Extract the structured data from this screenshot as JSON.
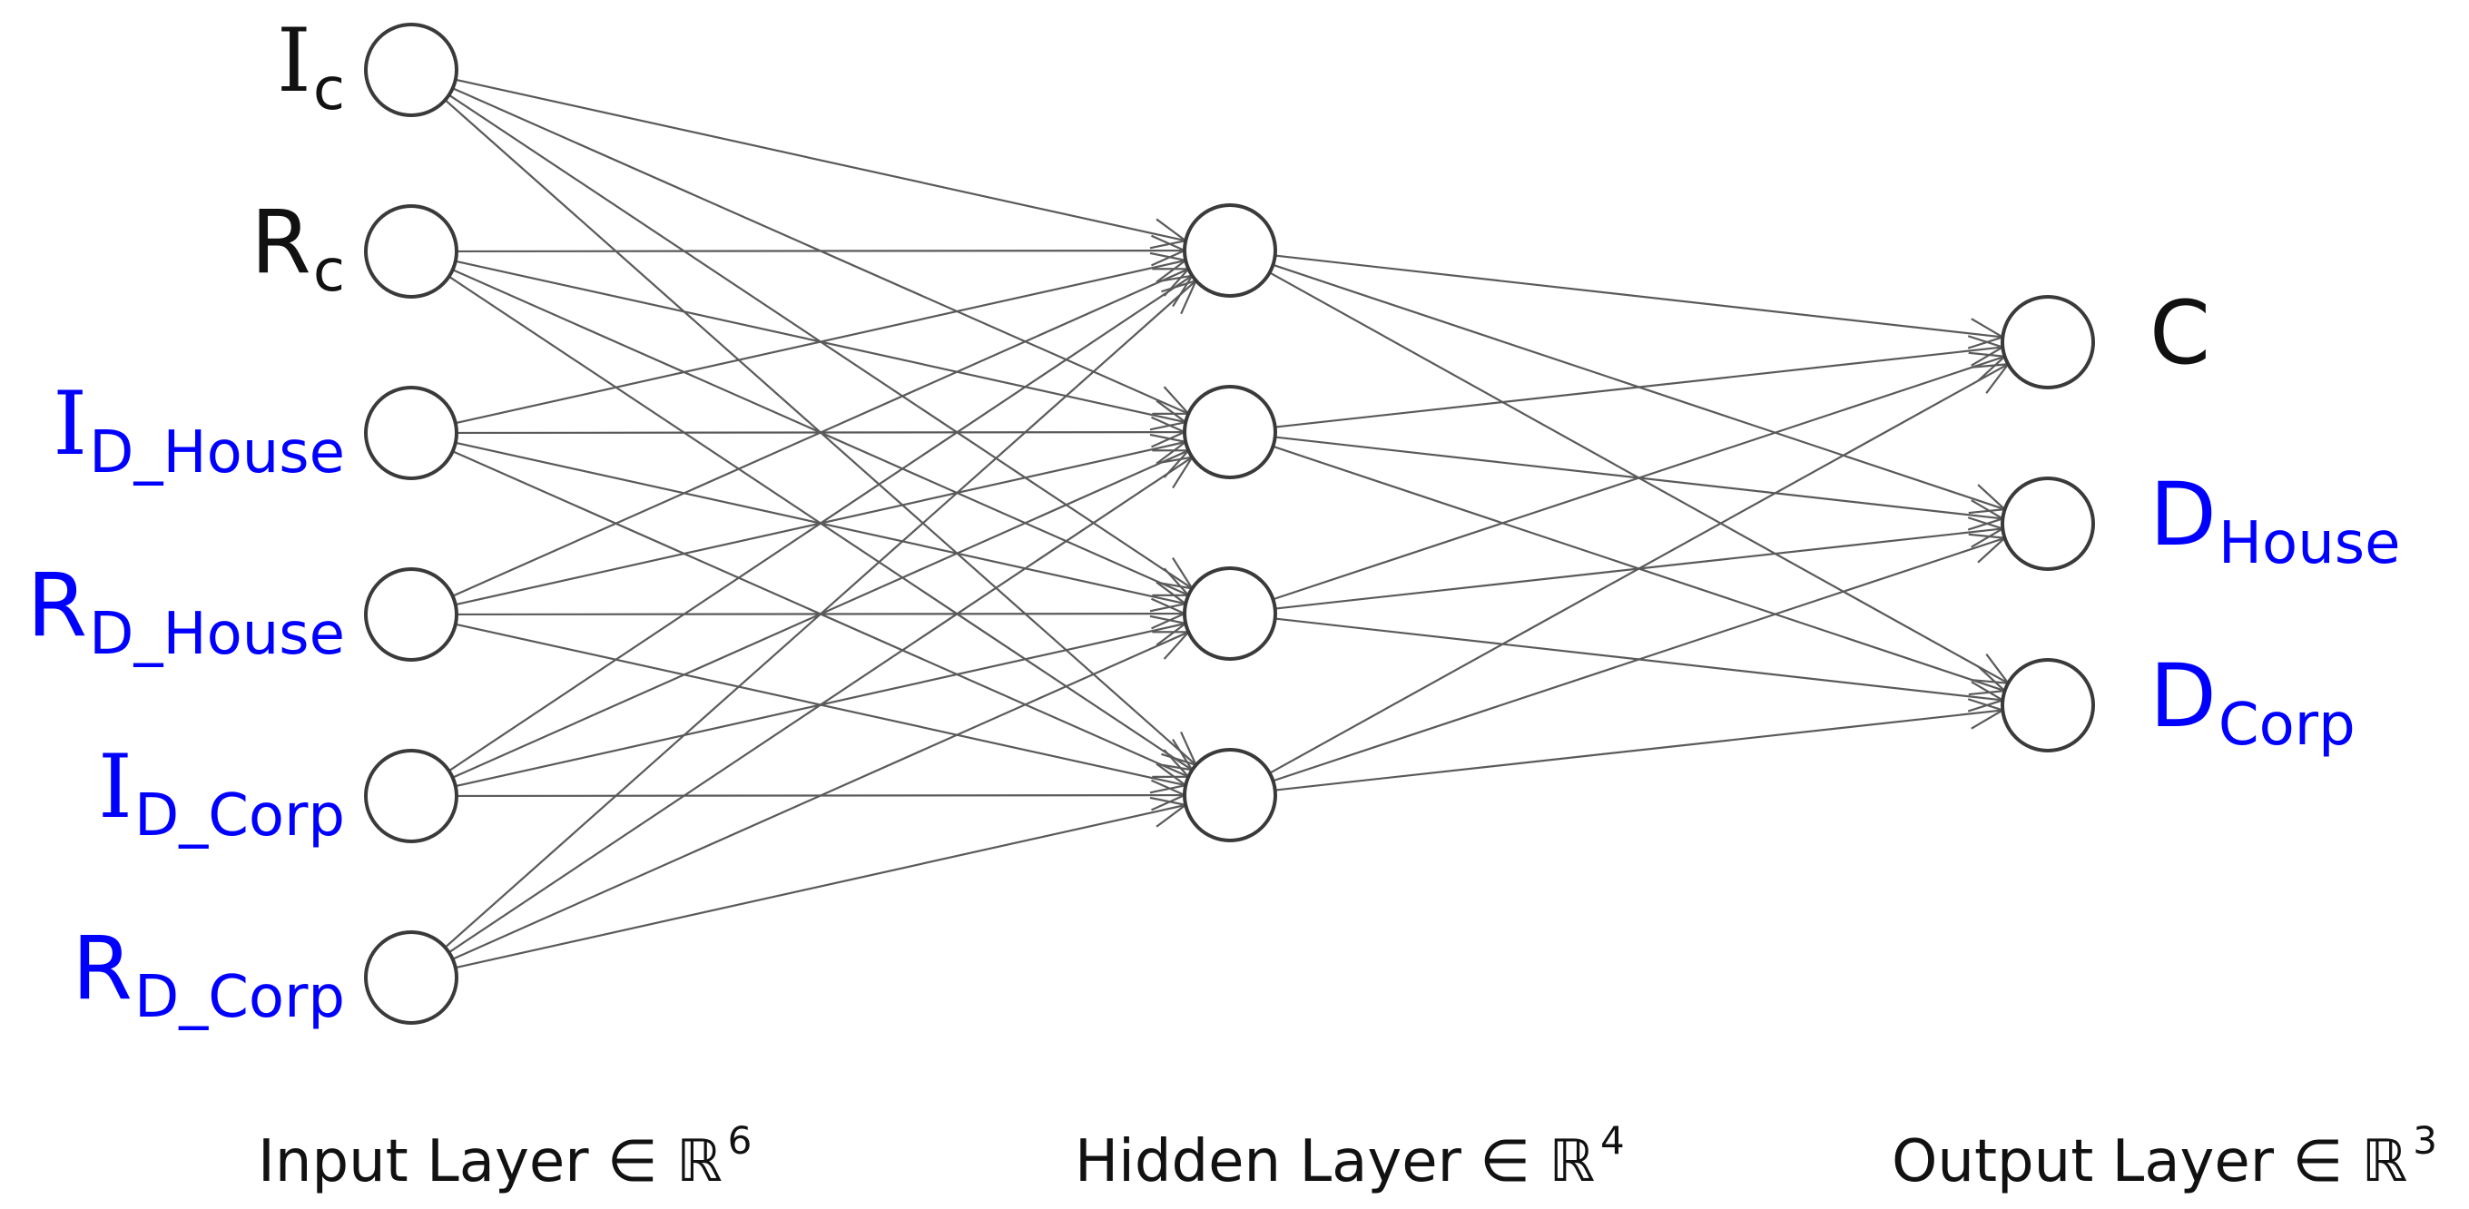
{
  "diagram": {
    "type": "feedforward-neural-network",
    "colors": {
      "black_label": "#111111",
      "blue_label": "#0000ff",
      "edge": "#5a5a5a",
      "node_stroke": "#3a3a3a",
      "node_fill": "#ffffff",
      "background": "#ffffff"
    },
    "layers": [
      {
        "id": "input",
        "caption": "Input Layer ∈ ℝ⁶",
        "caption_parts": {
          "text": "Input Layer ∈ ℝ",
          "superscript": "6"
        },
        "label_side": "left",
        "nodes": [
          {
            "id": "Ic",
            "main": "I",
            "sub": "c",
            "color": "black"
          },
          {
            "id": "Rc",
            "main": "R",
            "sub": "c",
            "color": "black"
          },
          {
            "id": "ID_House",
            "main": "I",
            "sub": "D_House",
            "color": "blue"
          },
          {
            "id": "RD_House",
            "main": "R",
            "sub": "D_House",
            "color": "blue"
          },
          {
            "id": "ID_Corp",
            "main": "I",
            "sub": "D_Corp",
            "color": "blue"
          },
          {
            "id": "RD_Corp",
            "main": "R",
            "sub": "D_Corp",
            "color": "blue"
          }
        ]
      },
      {
        "id": "hidden",
        "caption": "Hidden Layer ∈ ℝ⁴",
        "caption_parts": {
          "text": "Hidden Layer ∈ ℝ",
          "superscript": "4"
        },
        "label_side": "none",
        "nodes": [
          {
            "id": "h1",
            "main": "",
            "sub": "",
            "color": "black"
          },
          {
            "id": "h2",
            "main": "",
            "sub": "",
            "color": "black"
          },
          {
            "id": "h3",
            "main": "",
            "sub": "",
            "color": "black"
          },
          {
            "id": "h4",
            "main": "",
            "sub": "",
            "color": "black"
          }
        ]
      },
      {
        "id": "output",
        "caption": "Output Layer ∈ ℝ³",
        "caption_parts": {
          "text": "Output Layer ∈ ℝ",
          "superscript": "3"
        },
        "label_side": "right",
        "nodes": [
          {
            "id": "C",
            "main": "C",
            "sub": "",
            "color": "black"
          },
          {
            "id": "D_House",
            "main": "D",
            "sub": "House",
            "color": "blue"
          },
          {
            "id": "D_Corp",
            "main": "D",
            "sub": "Corp",
            "color": "blue"
          }
        ]
      }
    ],
    "connectivity": "fully-connected",
    "edge_style": "directed-open-arrow"
  }
}
